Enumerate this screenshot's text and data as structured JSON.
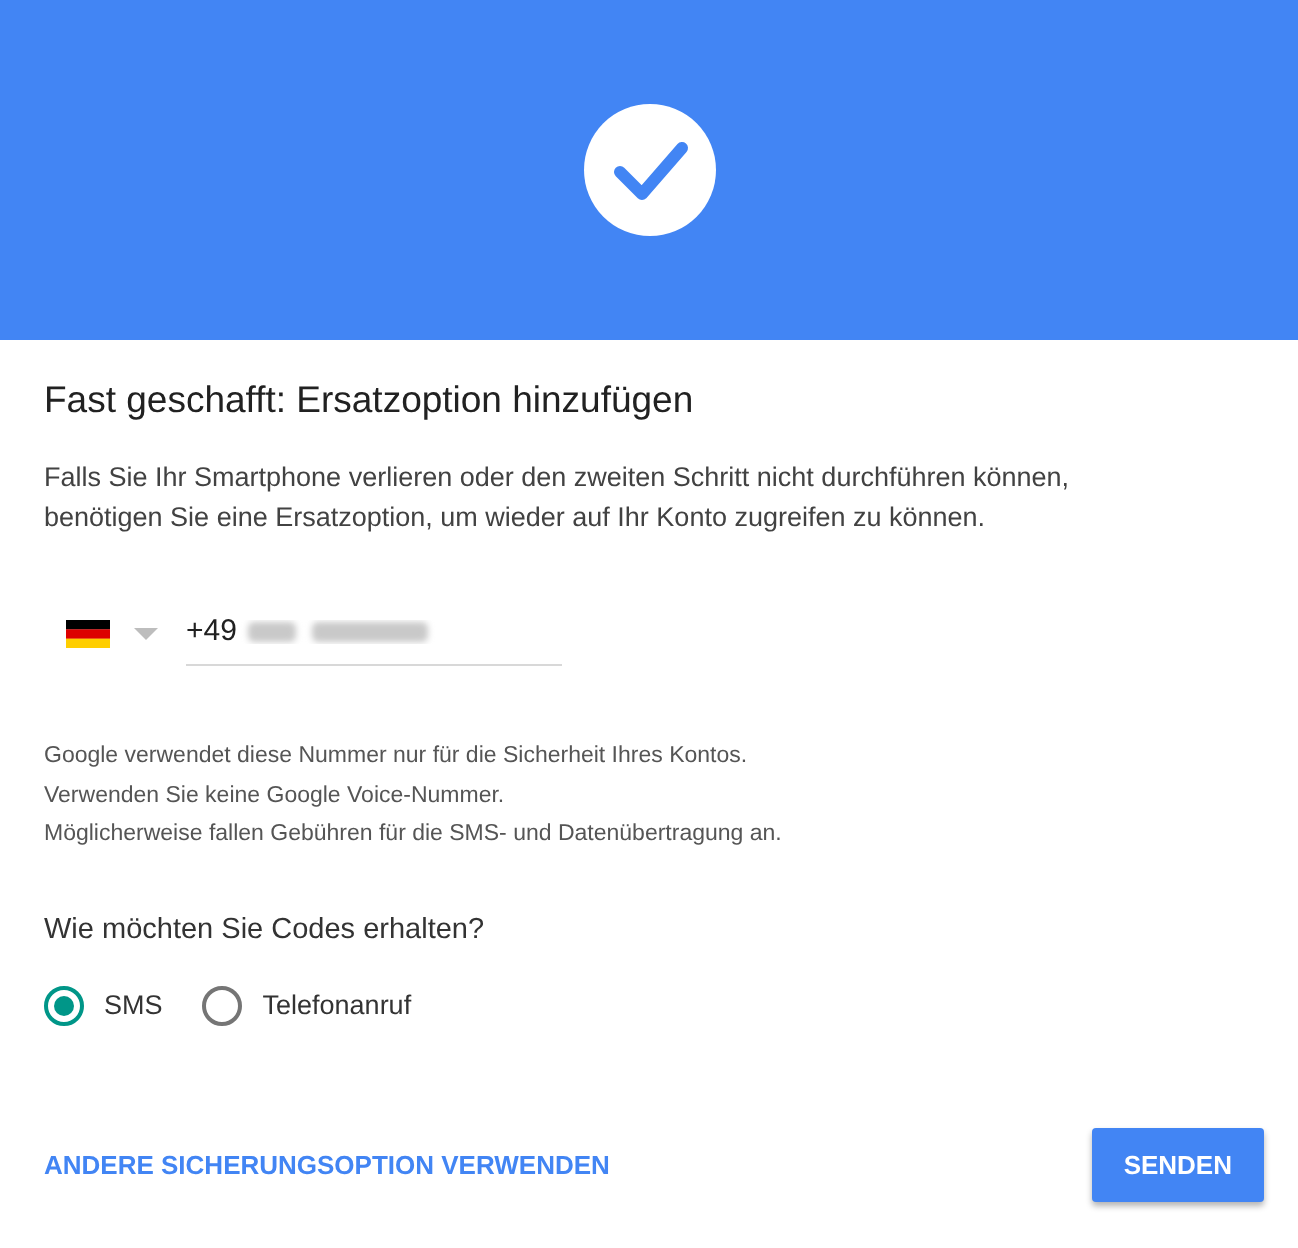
{
  "header": {
    "kind": "success"
  },
  "title": "Fast geschafft: Ersatzoption hinzufügen",
  "intro": "Falls Sie Ihr Smartphone verlieren oder den zweiten Schritt nicht durchführen können, benötigen Sie eine Ersatzoption, um wieder auf Ihr Konto zugreifen zu können.",
  "phone": {
    "prefix": "+49"
  },
  "notes": [
    "Google verwendet diese Nummer nur für die Sicherheit Ihres Kontos.",
    "Verwenden Sie keine Google Voice-Nummer.",
    "Möglicherweise fallen Gebühren für die SMS- und Datenübertragung an."
  ],
  "question": "Wie möchten Sie Codes erhalten?",
  "options": [
    {
      "label": "SMS",
      "selected": true
    },
    {
      "label": "Telefonanruf",
      "selected": false
    }
  ],
  "link": "ANDERE SICHERUNGSOPTION VERWENDEN",
  "button": "SENDEN"
}
